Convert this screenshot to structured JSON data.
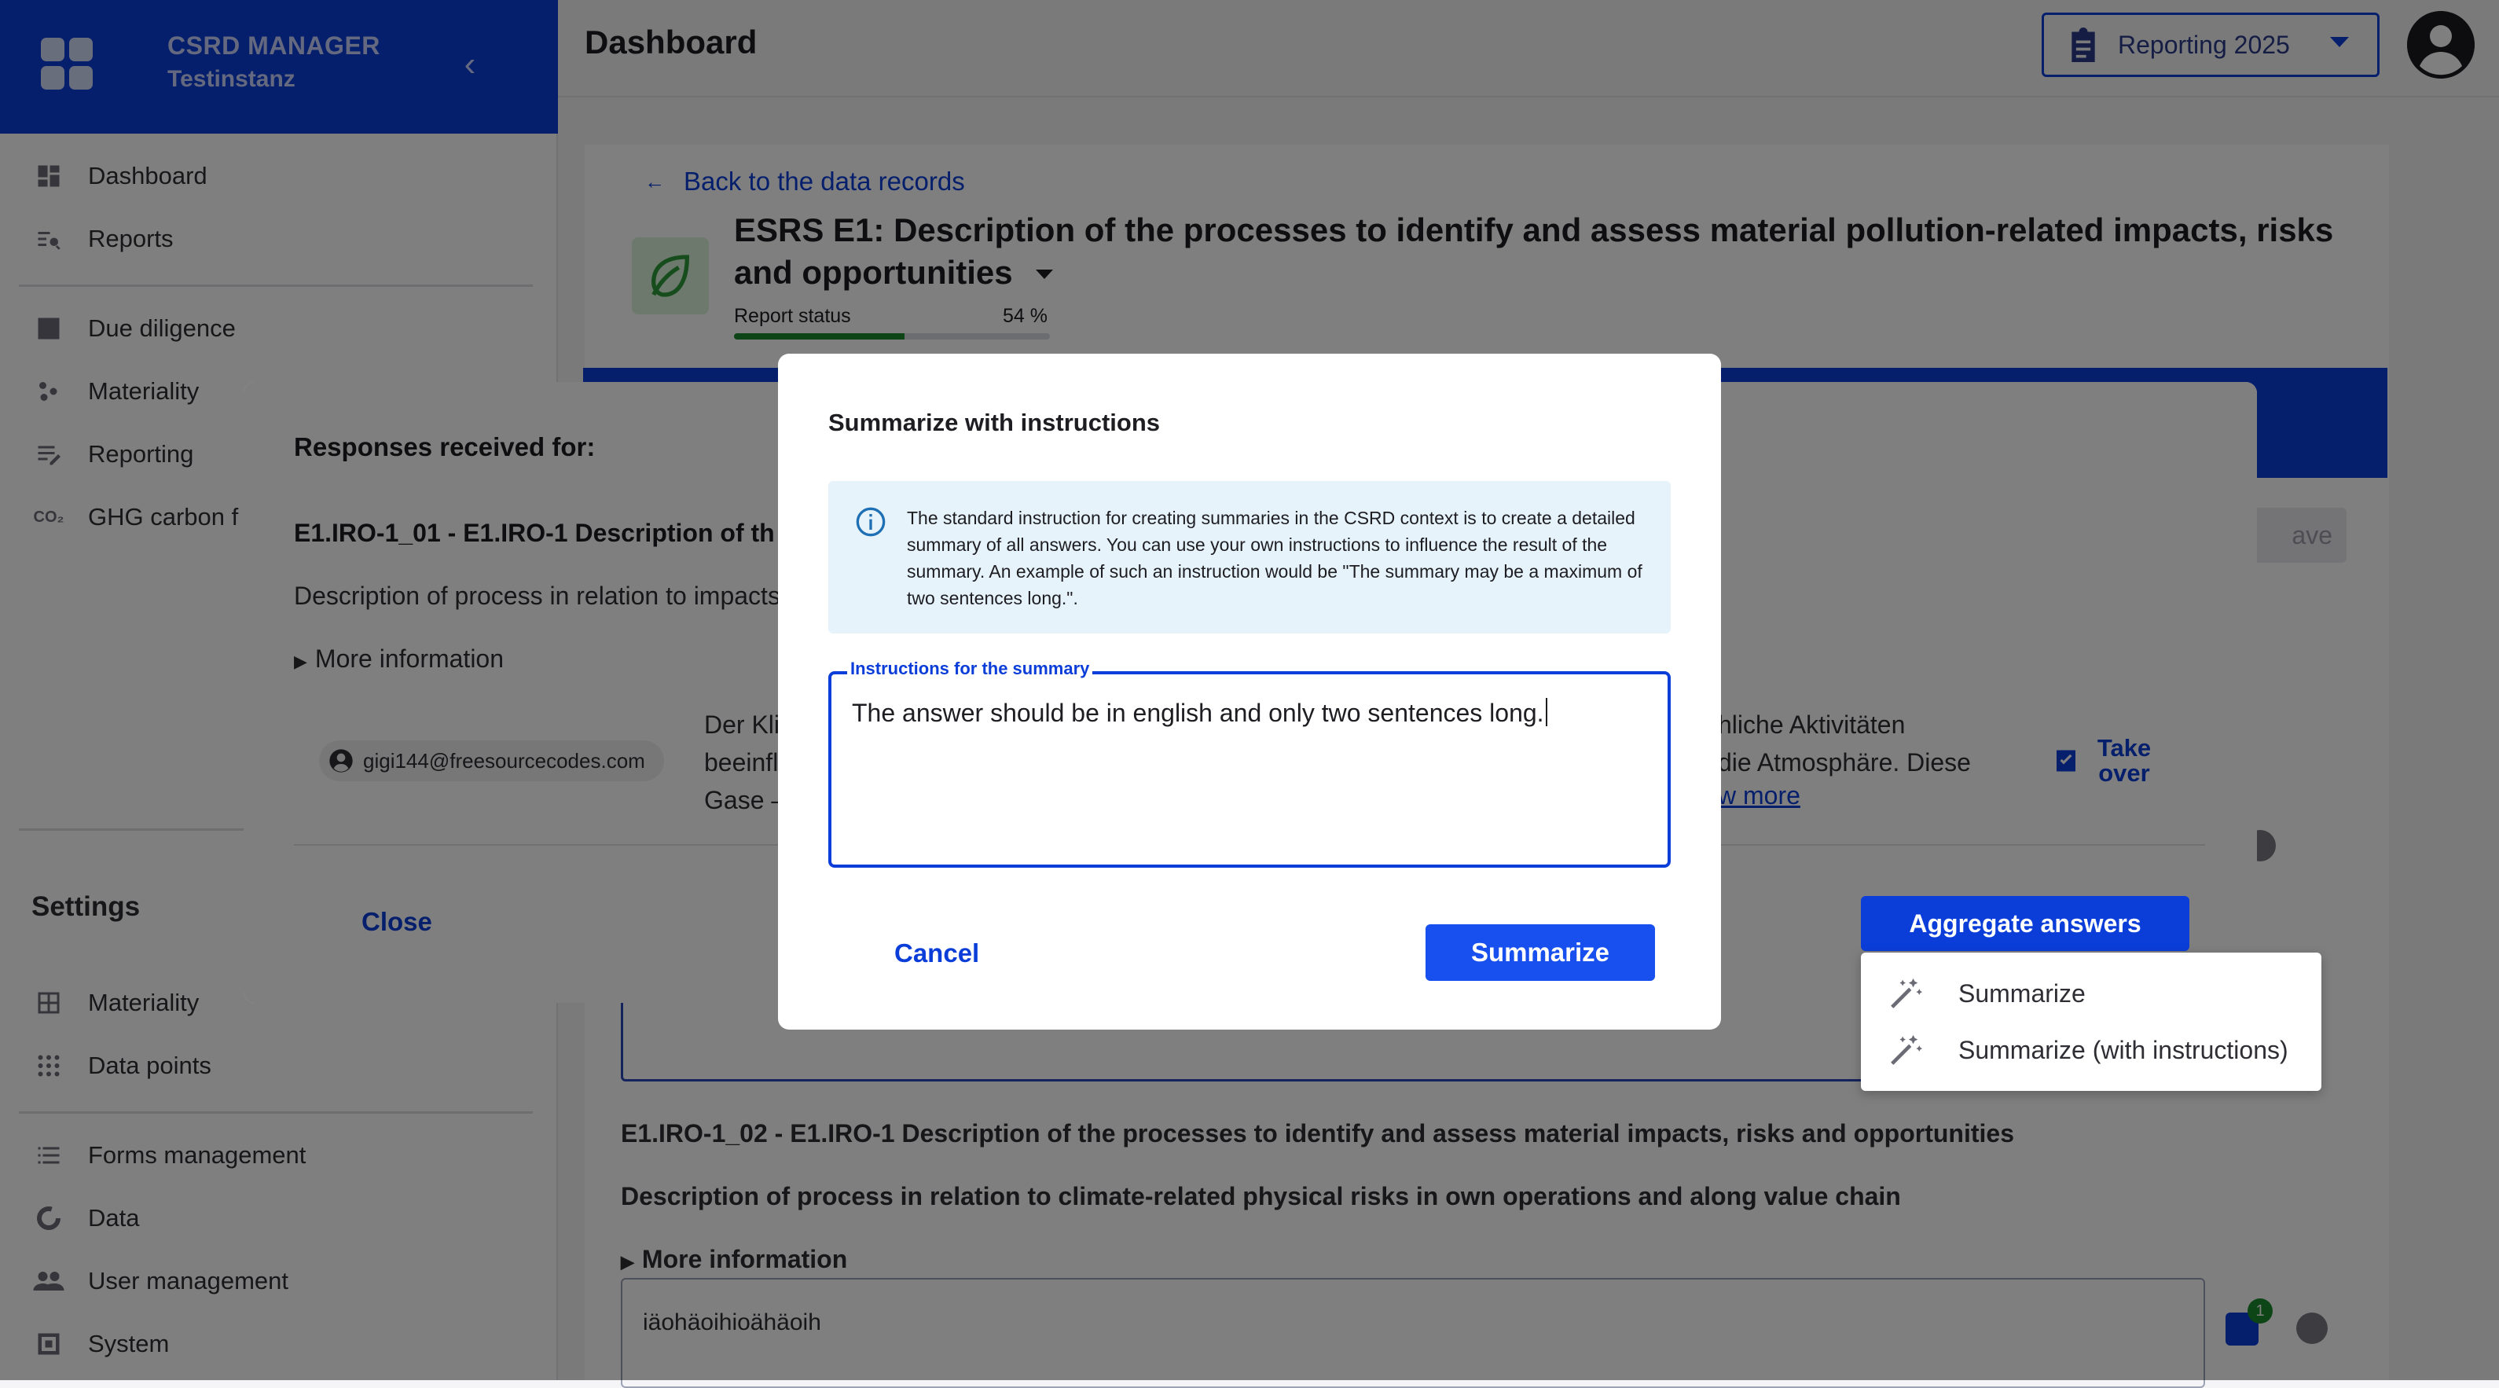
{
  "sidebar": {
    "app_title": "CSRD MANAGER",
    "instance": "Testinstanz",
    "nav_main": [
      {
        "label": "Dashboard",
        "icon": "dashboard-icon"
      },
      {
        "label": "Reports",
        "icon": "reports-icon"
      }
    ],
    "nav_group2": [
      {
        "label": "Due diligence",
        "icon": "bar-chart-icon"
      },
      {
        "label": "Materiality",
        "icon": "scatter-icon"
      },
      {
        "label": "Reporting",
        "icon": "list-edit-icon"
      },
      {
        "label": "GHG carbon f",
        "icon": "co2-icon"
      }
    ],
    "settings_heading": "Settings",
    "settings_items": [
      {
        "label": "Materiality",
        "icon": "grid-icon"
      },
      {
        "label": "Data points",
        "icon": "dots-icon"
      }
    ],
    "admin_items": [
      {
        "label": "Forms management",
        "icon": "list-icon"
      },
      {
        "label": "Data",
        "icon": "donut-icon"
      },
      {
        "label": "User management",
        "icon": "users-icon"
      },
      {
        "label": "System",
        "icon": "system-icon"
      }
    ]
  },
  "topbar": {
    "title": "Dashboard",
    "reporting_select": "Reporting 2025"
  },
  "record": {
    "back_link": "Back to the data records",
    "title": "ESRS E1: Description of the processes to identify and assess material pollution-related impacts, risks and opportunities",
    "status_label": "Report status",
    "status_percent_text": "54 %",
    "status_percent": 54,
    "save_label": "ave"
  },
  "background_question2": {
    "code": "E1.IRO-1_02 - E1.IRO-1 Description of the processes to identify and assess material impacts, risks and opportunities",
    "description": "Description of process in relation to climate-related physical risks in own operations and along value chain",
    "more_info": "More information",
    "value": "iäohäoihioähäoih",
    "badge_count": "1"
  },
  "responses_dialog": {
    "heading": "Responses received for:",
    "code": "E1.IRO-1_01 - E1.IRO-1 Description of th",
    "description": "Description of process in relation to impacts",
    "more_info": "More information",
    "user": "gigi144@freesourcecodes.com",
    "answer_left": "Der Kli\nbeeinfl\nGase –",
    "answer_right": "hliche Aktivitäten\ndie Atmosphäre. Diese",
    "show_more": "w more",
    "take_over": "Take over",
    "close": "Close",
    "aggregate": "Aggregate answers",
    "aggregate_menu": [
      "Summarize",
      "Summarize (with instructions)"
    ]
  },
  "summarize_dialog": {
    "heading": "Summarize with instructions",
    "info": "The standard instruction for creating summaries in the CSRD context is to create a detailed summary of all answers. You can use your own instructions to influence the result of the summary. An example of such an instruction would be \"The summary may be a maximum of two sentences long.\".",
    "field_label": "Instructions for the summary",
    "field_value": "The answer should be in english and only two sentences long.",
    "cancel": "Cancel",
    "submit": "Summarize"
  },
  "colors": {
    "primary": "#0b3ed9",
    "progress": "#1c8a2c",
    "info_bg": "#e6f3fb",
    "leaf_bg": "#d8f2d9"
  }
}
